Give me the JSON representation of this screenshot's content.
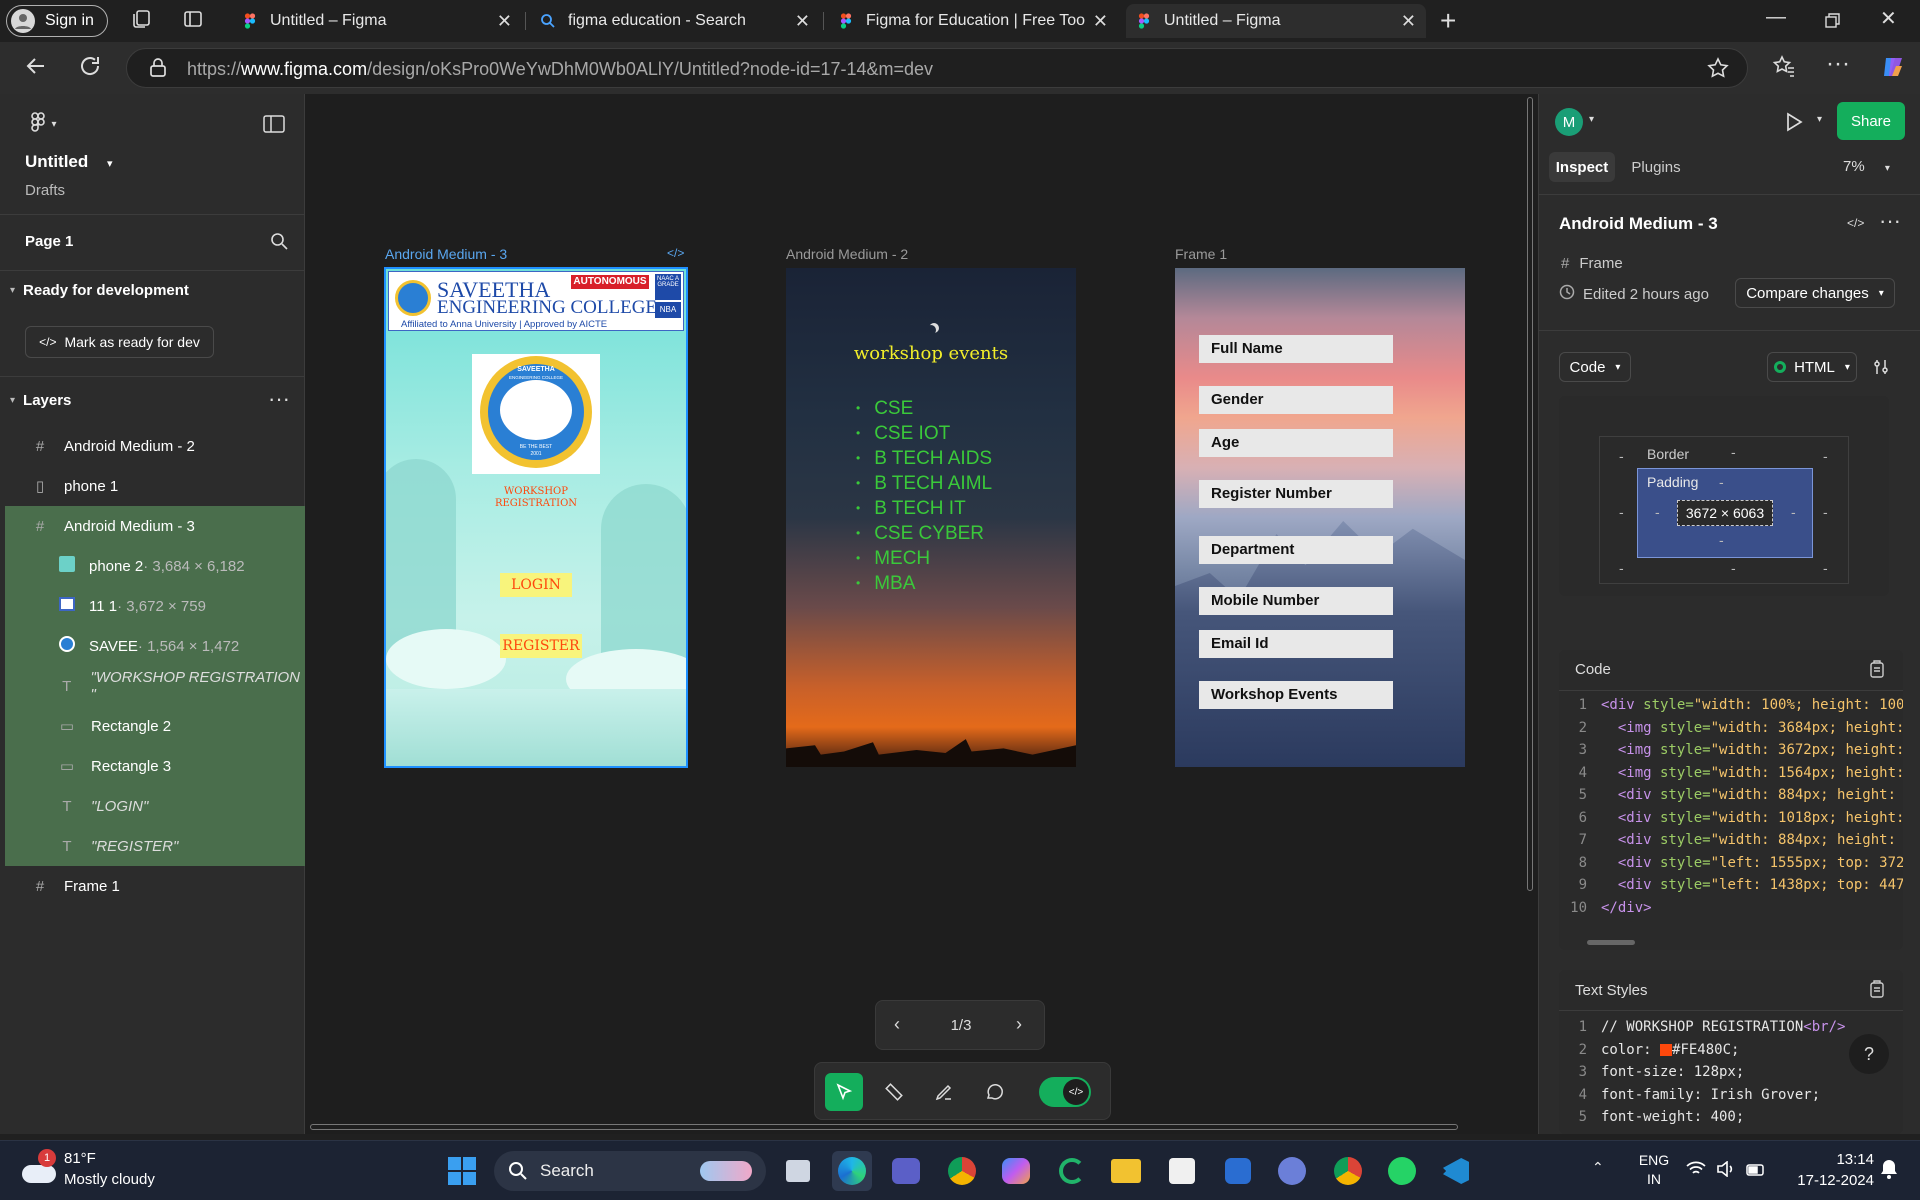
{
  "browser": {
    "signin_label": "Sign in",
    "tabs": [
      {
        "title": "Untitled – Figma",
        "icon": "figma-icon"
      },
      {
        "title": "figma education - Search",
        "icon": "search-icon"
      },
      {
        "title": "Figma for Education | Free Tools f",
        "icon": "figma-icon"
      },
      {
        "title": "Untitled – Figma",
        "icon": "figma-icon"
      }
    ],
    "url_prefix": "https://",
    "url_host": "www.figma.com",
    "url_path": "/design/oKsPro0WeYwDhM0Wb0ALlY/Untitled?node-id=17-14&m=dev"
  },
  "left_panel": {
    "file_title": "Untitled",
    "file_location": "Drafts",
    "page_name": "Page 1",
    "dev_section_title": "Ready for development",
    "mark_ready_label": "Mark as ready for dev",
    "layers_title": "Layers",
    "layers": [
      {
        "label": "Android Medium - 2",
        "icon": "frame-icon"
      },
      {
        "label": "phone 1",
        "icon": "image-icon"
      },
      {
        "label": "Android Medium - 3",
        "icon": "frame-icon"
      },
      {
        "label": "phone 2",
        "meta": " · 3,684 × 6,182",
        "icon": "image-icon"
      },
      {
        "label": "11 1",
        "meta": " · 3,672 × 759",
        "icon": "image-icon"
      },
      {
        "label": "SAVEE",
        "meta": " · 1,564 × 1,472",
        "icon": "image-icon"
      },
      {
        "label": "\"WORKSHOP REGISTRATION \"",
        "icon": "text-icon"
      },
      {
        "label": "Rectangle 2",
        "icon": "rectangle-icon"
      },
      {
        "label": "Rectangle 3",
        "icon": "rectangle-icon"
      },
      {
        "label": "\"LOGIN\"",
        "icon": "text-icon"
      },
      {
        "label": "\"REGISTER\"",
        "icon": "text-icon"
      },
      {
        "label": "Frame 1",
        "icon": "frame-icon"
      }
    ]
  },
  "canvas": {
    "frame_labels": [
      "Android Medium - 3",
      "Android Medium - 2",
      "Frame 1"
    ],
    "frame3": {
      "autonomous": "AUTONOMOUS",
      "college_line1": "SAVEETHA",
      "college_line2": "ENGINEERING COLLEGE",
      "affiliation": "Affiliated to Anna University | Approved by AICTE",
      "naac": "NAAC A GRADE",
      "nba": "NBA",
      "seal_top": "SAVEETHA",
      "seal_sub": "ENGINEERING COLLEGE",
      "seal_motto": "BE THE BEST",
      "seal_year": "2001",
      "workshop_line1": "WORKSHOP",
      "workshop_line2": "REGISTRATION",
      "login_label": "LOGIN",
      "register_label": "REGISTER"
    },
    "frame2": {
      "title": "workshop events",
      "events": [
        "CSE",
        "CSE IOT",
        "B TECH AIDS",
        "B TECH AIML",
        "B TECH IT",
        "CSE CYBER",
        "MECH",
        "MBA"
      ]
    },
    "frame1": {
      "fields": [
        "Full Name",
        "Gender",
        "Age",
        "Register Number",
        "Department",
        "Mobile Number",
        "Email Id",
        "Workshop Events"
      ]
    },
    "pager": "1/3"
  },
  "right_panel": {
    "avatar_letter": "M",
    "share_label": "Share",
    "tab_inspect": "Inspect",
    "tab_plugins": "Plugins",
    "zoom": "7%",
    "selection_name": "Android Medium - 3",
    "type_label": "Frame",
    "edited": "Edited 2 hours ago",
    "compare_label": "Compare changes",
    "code_dropdown": "Code",
    "lang_dropdown": "HTML",
    "box_border": "Border",
    "box_padding": "Padding",
    "box_dash": "-",
    "box_size": "3672 × 6063",
    "code_title": "Code",
    "code_lines": [
      {
        "n": "1",
        "indent": "",
        "tag": "<div",
        "attr": " style=",
        "val": "\"width: 100%; height: 100"
      },
      {
        "n": "2",
        "indent": "  ",
        "tag": "<img",
        "attr": " style=",
        "val": "\"width: 3684px; height:"
      },
      {
        "n": "3",
        "indent": "  ",
        "tag": "<img",
        "attr": " style=",
        "val": "\"width: 3672px; height:"
      },
      {
        "n": "4",
        "indent": "  ",
        "tag": "<img",
        "attr": " style=",
        "val": "\"width: 1564px; height:"
      },
      {
        "n": "5",
        "indent": "  ",
        "tag": "<div",
        "attr": " style=",
        "val": "\"width: 884px; height:"
      },
      {
        "n": "6",
        "indent": "  ",
        "tag": "<div",
        "attr": " style=",
        "val": "\"width: 1018px; height:"
      },
      {
        "n": "7",
        "indent": "  ",
        "tag": "<div",
        "attr": " style=",
        "val": "\"width: 884px; height:"
      },
      {
        "n": "8",
        "indent": "  ",
        "tag": "<div",
        "attr": " style=",
        "val": "\"left: 1555px; top: 372"
      },
      {
        "n": "9",
        "indent": "  ",
        "tag": "<div",
        "attr": " style=",
        "val": "\"left: 1438px; top: 447"
      },
      {
        "n": "10",
        "indent": "",
        "tag": "</div>",
        "attr": "",
        "val": ""
      }
    ],
    "text_styles_title": "Text Styles",
    "style_lines": [
      {
        "n": "1",
        "text": "// WORKSHOP REGISTRATION",
        "extra": "<br/>"
      },
      {
        "n": "2",
        "text": "color:",
        "extra": "#FE480C;"
      },
      {
        "n": "3",
        "text": "font-size: 128px;",
        "extra": ""
      },
      {
        "n": "4",
        "text": "font-family: Irish Grover;",
        "extra": ""
      },
      {
        "n": "5",
        "text": "font-weight: 400;",
        "extra": ""
      }
    ],
    "swatch_color": "#FE480C"
  },
  "taskbar": {
    "weather_temp": "81°F",
    "weather_desc": "Mostly cloudy",
    "weather_badge": "1",
    "search_label": "Search",
    "lang_line1": "ENG",
    "lang_line2": "IN",
    "time": "13:14",
    "date": "17-12-2024"
  },
  "colors": {
    "accent_green": "#14ae5c",
    "selection_blue": "#0d99ff",
    "layer_selected": "#4a6e4c"
  }
}
